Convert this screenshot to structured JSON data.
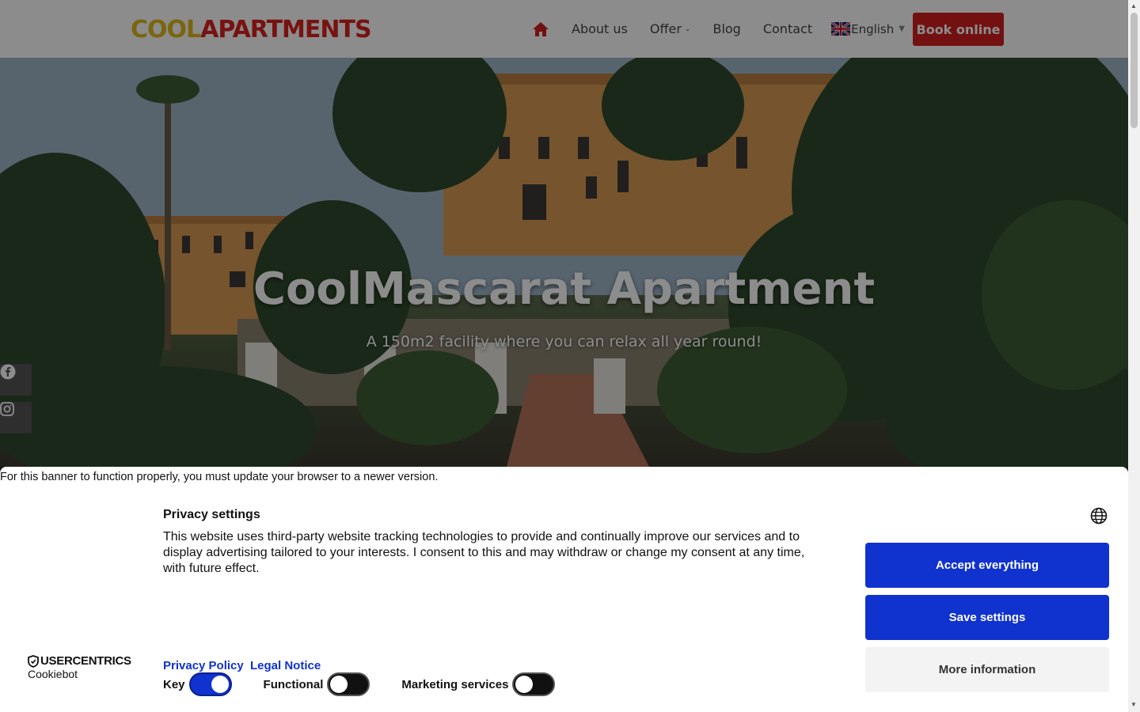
{
  "header": {
    "logo_part1": "COOL",
    "logo_part2": "APARTMENTS",
    "nav": {
      "home_icon": "home-icon",
      "about": "About us",
      "offer": "Offer",
      "blog": "Blog",
      "contact": "Contact",
      "language": "English"
    },
    "book_button": "Book online",
    "colors": {
      "logo_yellow": "#e0b81b",
      "logo_red": "#d8231f",
      "book_button": "#d11f1f"
    }
  },
  "hero": {
    "title": "CoolMascarat Apartment",
    "subtitle": "A 150m2 facility where you can relax all year round!",
    "social": [
      "facebook-icon",
      "instagram-icon"
    ]
  },
  "cookie_banner": {
    "update_note": "For this banner to function properly, you must update your browser to a newer version.",
    "title": "Privacy settings",
    "text": "This website uses third-party website tracking technologies to provide and continually improve our services and to display advertising tailored to your interests. I consent to this and may withdraw or change my consent at any time, with future effect.",
    "buttons": {
      "accept": "Accept everything",
      "save": "Save settings",
      "more": "More information"
    },
    "links": {
      "privacy": "Privacy Policy",
      "legal": "Legal Notice"
    },
    "brand": "USERCENTRICS",
    "brand_sub": "Cookiebot",
    "toggles": {
      "key": {
        "label": "Key",
        "on": true
      },
      "functional": {
        "label": "Functional",
        "on": false
      },
      "marketing": {
        "label": "Marketing services",
        "on": false
      }
    },
    "colors": {
      "primary": "#1032cf"
    }
  }
}
